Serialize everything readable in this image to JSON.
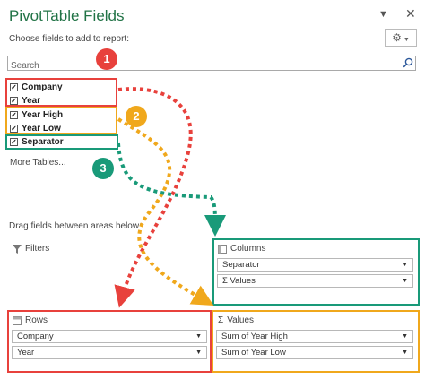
{
  "panel": {
    "title": "PivotTable Fields",
    "choose_label": "Choose fields to add to report:",
    "search_placeholder": "Search"
  },
  "fields": [
    {
      "label": "Company",
      "checked": true
    },
    {
      "label": "Year",
      "checked": true
    },
    {
      "label": "Year High",
      "checked": true
    },
    {
      "label": "Year Low",
      "checked": true
    },
    {
      "label": "Separator",
      "checked": true
    }
  ],
  "more_tables": "More Tables...",
  "drag_label": "Drag fields between areas below:",
  "areas": {
    "filters": {
      "label": "Filters"
    },
    "columns": {
      "label": "Columns",
      "items": [
        "Separator",
        "Values"
      ]
    },
    "rows": {
      "label": "Rows",
      "items": [
        "Company",
        "Year"
      ]
    },
    "values": {
      "label": "Values",
      "items": [
        "Sum of Year High",
        "Sum of Year Low"
      ]
    }
  },
  "annotations": {
    "badges": [
      "1",
      "2",
      "3"
    ],
    "colors": {
      "red": "#e8413c",
      "orange": "#f0a81c",
      "green": "#199a79"
    }
  },
  "icons": {
    "dropdown": "chevron-down-icon",
    "close": "close-icon",
    "settings": "gear-icon",
    "search": "search-icon",
    "filter": "filter-icon",
    "columns": "columns-icon",
    "rows": "rows-icon",
    "values": "sigma-icon"
  }
}
